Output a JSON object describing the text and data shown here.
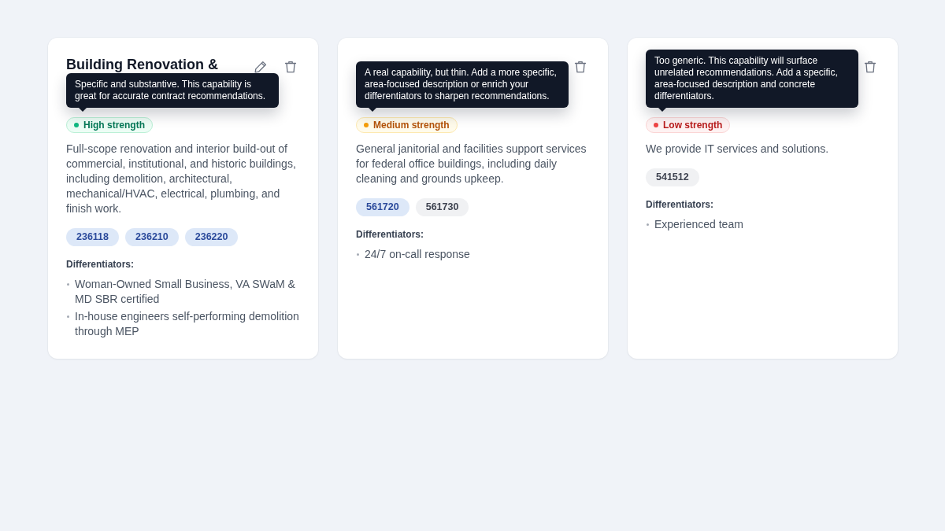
{
  "cards": [
    {
      "title": "Building Renovation &",
      "actions": [
        {
          "kind": "edit"
        },
        {
          "kind": "delete"
        }
      ],
      "tooltip": "Specific and substantive. This capability is great for accurate contract recommendations.",
      "strength": {
        "kind": "high",
        "label": "High strength"
      },
      "description": "Full-scope renovation and interior build-out of commercial, institutional, and historic buildings, including demolition, architectural, mechanical/HVAC, electrical, plumbing, and finish work.",
      "naics_codes": [
        {
          "code": "236118",
          "highlighted": true
        },
        {
          "code": "236210",
          "highlighted": true
        },
        {
          "code": "236220",
          "highlighted": true
        }
      ],
      "differentiators_label": "Differentiators:",
      "differentiators": [
        "Woman-Owned Small Business, VA SWaM & MD SBR certified",
        "In-house engineers self-performing demolition through MEP"
      ]
    },
    {
      "actions": [
        {
          "kind": "delete"
        }
      ],
      "tooltip": "A real capability, but thin. Add a more specific, area-focused description or enrich your differentiators to sharpen recommendations.",
      "strength": {
        "kind": "medium",
        "label": "Medium strength"
      },
      "description": "General janitorial and facilities support services for federal office buildings, including daily cleaning and grounds upkeep.",
      "naics_codes": [
        {
          "code": "561720",
          "highlighted": true
        },
        {
          "code": "561730",
          "highlighted": false
        }
      ],
      "differentiators_label": "Differentiators:",
      "differentiators": [
        "24/7 on-call response"
      ]
    },
    {
      "actions": [
        {
          "kind": "delete"
        }
      ],
      "tooltip": "Too generic. This capability will surface unrelated recommendations. Add a specific, area-focused description and concrete differentiators.",
      "strength": {
        "kind": "low",
        "label": "Low strength"
      },
      "description": "We provide IT services and solutions.",
      "naics_codes": [
        {
          "code": "541512",
          "highlighted": false
        }
      ],
      "differentiators_label": "Differentiators:",
      "differentiators": [
        "Experienced team"
      ]
    }
  ]
}
